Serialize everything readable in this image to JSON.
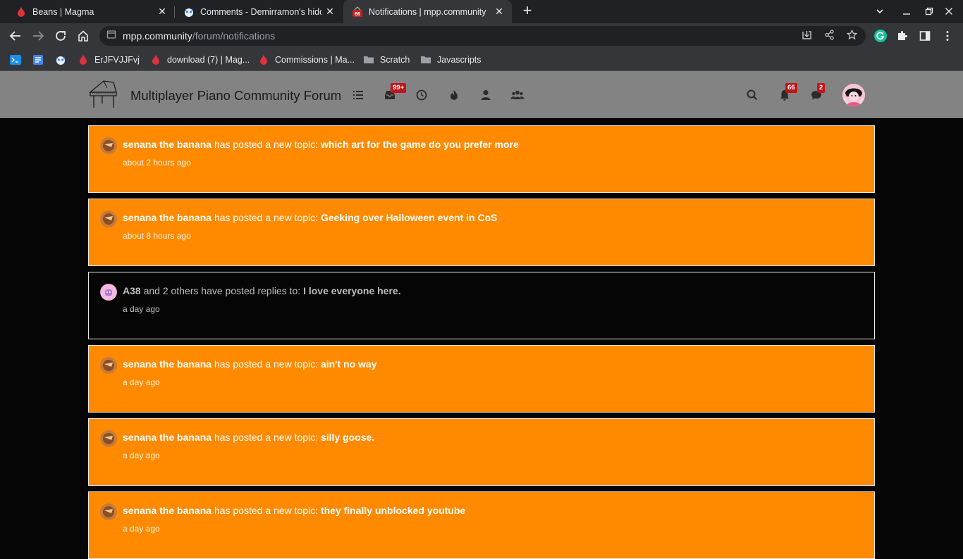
{
  "browser": {
    "tabs": [
      {
        "title": "Beans | Magma",
        "icon": "magma-icon"
      },
      {
        "title": "Comments - Demirramon's hidden",
        "icon": "paw-icon"
      },
      {
        "title": "Notifications | mpp.community",
        "icon": "mpp-icon",
        "badge": "66"
      }
    ],
    "address": {
      "host": "mpp.community",
      "path": "/forum/notifications"
    },
    "bookmarks": [
      {
        "label": "",
        "icon": "app-icon"
      },
      {
        "label": "",
        "icon": "docs-icon"
      },
      {
        "label": "",
        "icon": "paw-icon"
      },
      {
        "label": "ErJFVJJFvj",
        "icon": "magma-icon"
      },
      {
        "label": "download (7) | Mag...",
        "icon": "magma-icon"
      },
      {
        "label": "Commissions | Ma...",
        "icon": "magma-icon"
      },
      {
        "label": "Scratch",
        "icon": "folder-icon"
      },
      {
        "label": "Javascripts",
        "icon": "folder-icon"
      }
    ]
  },
  "forum": {
    "title": "Multiplayer Piano Community Forum",
    "nav_badges": {
      "inbox": "99+",
      "notifications": "66",
      "chats": "2"
    }
  },
  "notifications": [
    {
      "user": "senana the banana",
      "action": "has posted a new topic:",
      "topic": "which art for the game do you prefer more",
      "time": "about 2 hours ago",
      "unread": true
    },
    {
      "user": "senana the banana",
      "action": "has posted a new topic:",
      "topic": "Geeking over Halloween event in CoS",
      "time": "about 8 hours ago",
      "unread": true
    },
    {
      "user": "A38",
      "action": "and 2 others have posted replies to:",
      "topic": "I love everyone here.",
      "time": "a day ago",
      "unread": false
    },
    {
      "user": "senana the banana",
      "action": "has posted a new topic:",
      "topic": "ain't no way",
      "time": "a day ago",
      "unread": true
    },
    {
      "user": "senana the banana",
      "action": "has posted a new topic:",
      "topic": "silly goose.",
      "time": "a day ago",
      "unread": true
    },
    {
      "user": "senana the banana",
      "action": "has posted a new topic:",
      "topic": "they finally unblocked youtube",
      "time": "a day ago",
      "unread": true
    }
  ],
  "colors": {
    "unread_bg": "#ff8a00",
    "header_bg": "#838383",
    "badge": "#c0141a",
    "page_bg": "#050505"
  }
}
